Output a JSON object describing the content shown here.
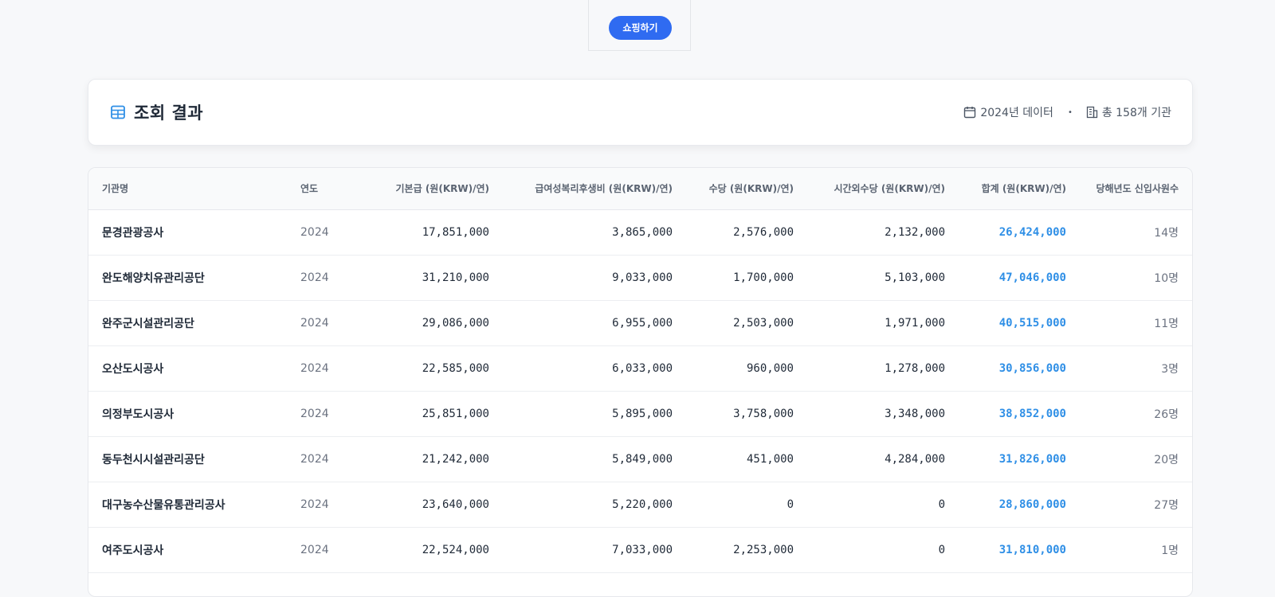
{
  "ad": {
    "button_label": "쇼핑하기"
  },
  "header": {
    "title": "조회 결과",
    "meta_year": "2024년 데이터",
    "meta_count": "총 158개 기관",
    "separator": "•"
  },
  "table": {
    "columns": [
      "기관명",
      "연도",
      "기본급 (원(KRW)/연)",
      "급여성복리후생비 (원(KRW)/연)",
      "수당 (원(KRW)/연)",
      "시간외수당 (원(KRW)/연)",
      "합계 (원(KRW)/연)",
      "당해년도 신입사원수"
    ],
    "rows": [
      [
        "문경관광공사",
        "2024",
        "17,851,000",
        "3,865,000",
        "2,576,000",
        "2,132,000",
        "26,424,000",
        "14명"
      ],
      [
        "완도해양치유관리공단",
        "2024",
        "31,210,000",
        "9,033,000",
        "1,700,000",
        "5,103,000",
        "47,046,000",
        "10명"
      ],
      [
        "완주군시설관리공단",
        "2024",
        "29,086,000",
        "6,955,000",
        "2,503,000",
        "1,971,000",
        "40,515,000",
        "11명"
      ],
      [
        "오산도시공사",
        "2024",
        "22,585,000",
        "6,033,000",
        "960,000",
        "1,278,000",
        "30,856,000",
        "3명"
      ],
      [
        "의정부도시공사",
        "2024",
        "25,851,000",
        "5,895,000",
        "3,758,000",
        "3,348,000",
        "38,852,000",
        "26명"
      ],
      [
        "동두천시시설관리공단",
        "2024",
        "21,242,000",
        "5,849,000",
        "451,000",
        "4,284,000",
        "31,826,000",
        "20명"
      ],
      [
        "대구농수산물유통관리공사",
        "2024",
        "23,640,000",
        "5,220,000",
        "0",
        "0",
        "28,860,000",
        "27명"
      ],
      [
        "여주도시공사",
        "2024",
        "22,524,000",
        "7,033,000",
        "2,253,000",
        "0",
        "31,810,000",
        "1명"
      ],
      [
        "",
        "",
        "",
        "",
        "",
        "",
        "",
        ""
      ]
    ]
  },
  "colors": {
    "accent": "#2f6bf1",
    "total_text": "#2f8fe6",
    "icon": "#2f8fe6"
  }
}
